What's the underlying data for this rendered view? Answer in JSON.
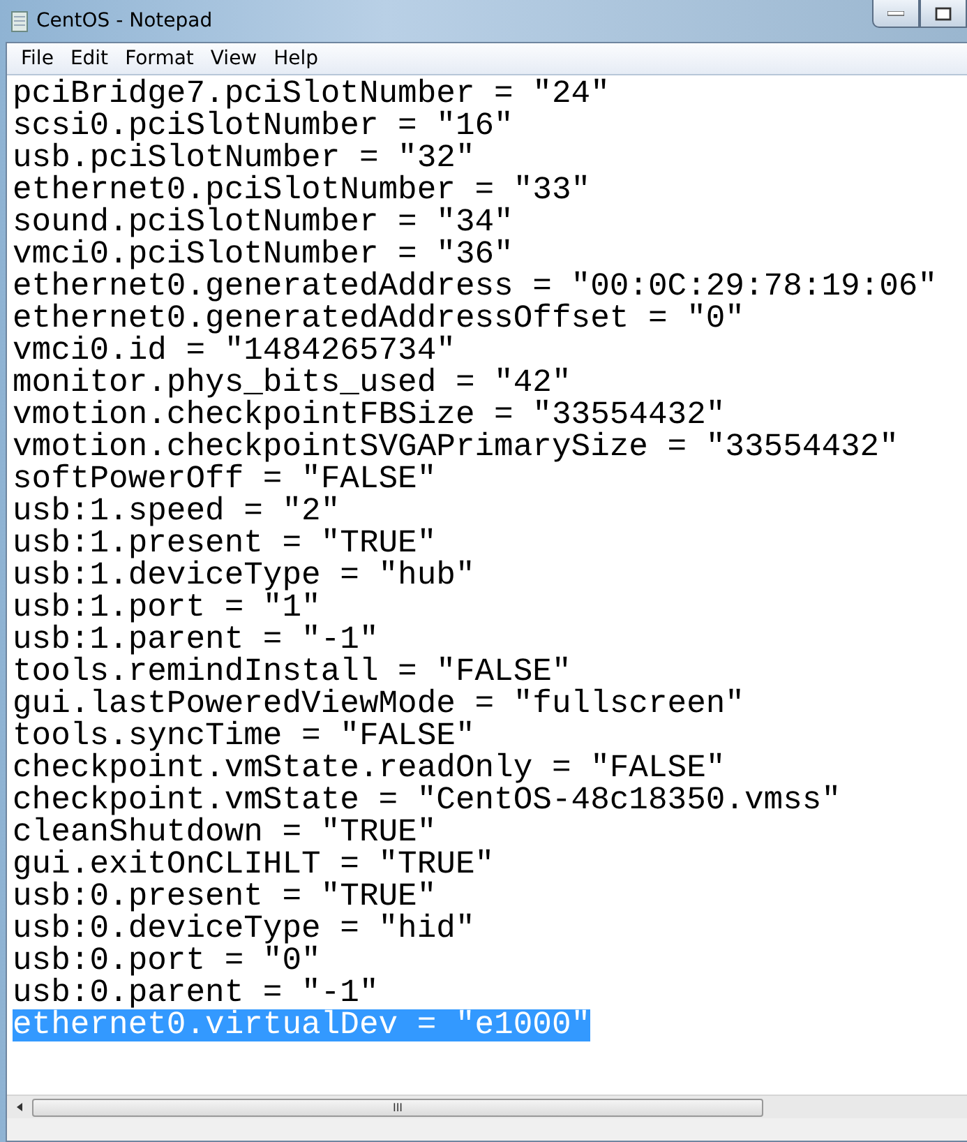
{
  "window": {
    "title": "CentOS - Notepad"
  },
  "menu": [
    "File",
    "Edit",
    "Format",
    "View",
    "Help"
  ],
  "lines": [
    {
      "text": "pciBridge7.pciSlotNumber = \"24\"",
      "selected": false
    },
    {
      "text": "scsi0.pciSlotNumber = \"16\"",
      "selected": false
    },
    {
      "text": "usb.pciSlotNumber = \"32\"",
      "selected": false
    },
    {
      "text": "ethernet0.pciSlotNumber = \"33\"",
      "selected": false
    },
    {
      "text": "sound.pciSlotNumber = \"34\"",
      "selected": false
    },
    {
      "text": "vmci0.pciSlotNumber = \"36\"",
      "selected": false
    },
    {
      "text": "ethernet0.generatedAddress = \"00:0C:29:78:19:06\"",
      "selected": false
    },
    {
      "text": "ethernet0.generatedAddressOffset = \"0\"",
      "selected": false
    },
    {
      "text": "vmci0.id = \"1484265734\"",
      "selected": false
    },
    {
      "text": "monitor.phys_bits_used = \"42\"",
      "selected": false
    },
    {
      "text": "vmotion.checkpointFBSize = \"33554432\"",
      "selected": false
    },
    {
      "text": "vmotion.checkpointSVGAPrimarySize = \"33554432\"",
      "selected": false
    },
    {
      "text": "softPowerOff = \"FALSE\"",
      "selected": false
    },
    {
      "text": "usb:1.speed = \"2\"",
      "selected": false
    },
    {
      "text": "usb:1.present = \"TRUE\"",
      "selected": false
    },
    {
      "text": "usb:1.deviceType = \"hub\"",
      "selected": false
    },
    {
      "text": "usb:1.port = \"1\"",
      "selected": false
    },
    {
      "text": "usb:1.parent = \"-1\"",
      "selected": false
    },
    {
      "text": "tools.remindInstall = \"FALSE\"",
      "selected": false
    },
    {
      "text": "gui.lastPoweredViewMode = \"fullscreen\"",
      "selected": false
    },
    {
      "text": "tools.syncTime = \"FALSE\"",
      "selected": false
    },
    {
      "text": "checkpoint.vmState.readOnly = \"FALSE\"",
      "selected": false
    },
    {
      "text": "checkpoint.vmState = \"CentOS-48c18350.vmss\"",
      "selected": false
    },
    {
      "text": "cleanShutdown = \"TRUE\"",
      "selected": false
    },
    {
      "text": "gui.exitOnCLIHLT = \"TRUE\"",
      "selected": false
    },
    {
      "text": "usb:0.present = \"TRUE\"",
      "selected": false
    },
    {
      "text": "usb:0.deviceType = \"hid\"",
      "selected": false
    },
    {
      "text": "usb:0.port = \"0\"",
      "selected": false
    },
    {
      "text": "usb:0.parent = \"-1\"",
      "selected": false
    },
    {
      "text": "ethernet0.virtualDev = \"e1000\"",
      "selected": true
    }
  ],
  "scrollbar": {
    "grip": "III"
  }
}
